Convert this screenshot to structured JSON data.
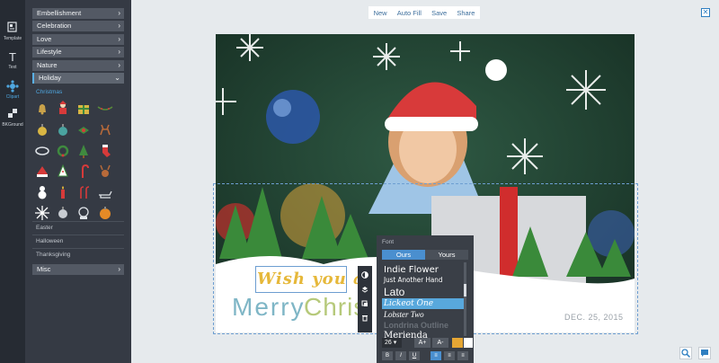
{
  "rail": {
    "items": [
      {
        "label": "Template",
        "icon": "template-icon"
      },
      {
        "label": "Text",
        "icon": "text-icon"
      },
      {
        "label": "Clipart",
        "icon": "clipart-icon"
      },
      {
        "label": "BKGround",
        "icon": "background-icon"
      }
    ]
  },
  "panel": {
    "categories": [
      {
        "label": "Embellishment"
      },
      {
        "label": "Celebration"
      },
      {
        "label": "Love"
      },
      {
        "label": "Lifestyle"
      },
      {
        "label": "Nature"
      },
      {
        "label": "Holiday"
      }
    ],
    "open_category": "Holiday",
    "subcategory_active": "Christmas",
    "subcategories": [
      "Easter",
      "Halloween",
      "Thanksgiving"
    ],
    "misc": "Misc"
  },
  "toolbar": {
    "new": "New",
    "auto_fill": "Auto Fill",
    "save": "Save",
    "share": "Share"
  },
  "canvas": {
    "greeting_line1": "Wish you a",
    "greeting_merry": "Merry",
    "greeting_christ": "Chris",
    "date": "DEC. 25, 2015"
  },
  "font_panel": {
    "title": "Font",
    "tabs": [
      "Ours",
      "Yours"
    ],
    "active_tab": "Ours",
    "fonts": [
      "Indie Flower",
      "Just Another Hand",
      "Lato",
      "Lickeot One",
      "Lobster Two",
      "Londrina Outline",
      "Merienda"
    ],
    "selected_font": "Lickeot One",
    "size": "26",
    "increase": "A+",
    "decrease": "A-",
    "color": "#e5a634",
    "format_buttons": [
      "B",
      "I",
      "U"
    ]
  },
  "colors": {
    "accent": "#4a8fcf",
    "rail_bg": "#262b33",
    "panel_bg": "#353a44",
    "greeting_gold": "#e6b83a"
  }
}
